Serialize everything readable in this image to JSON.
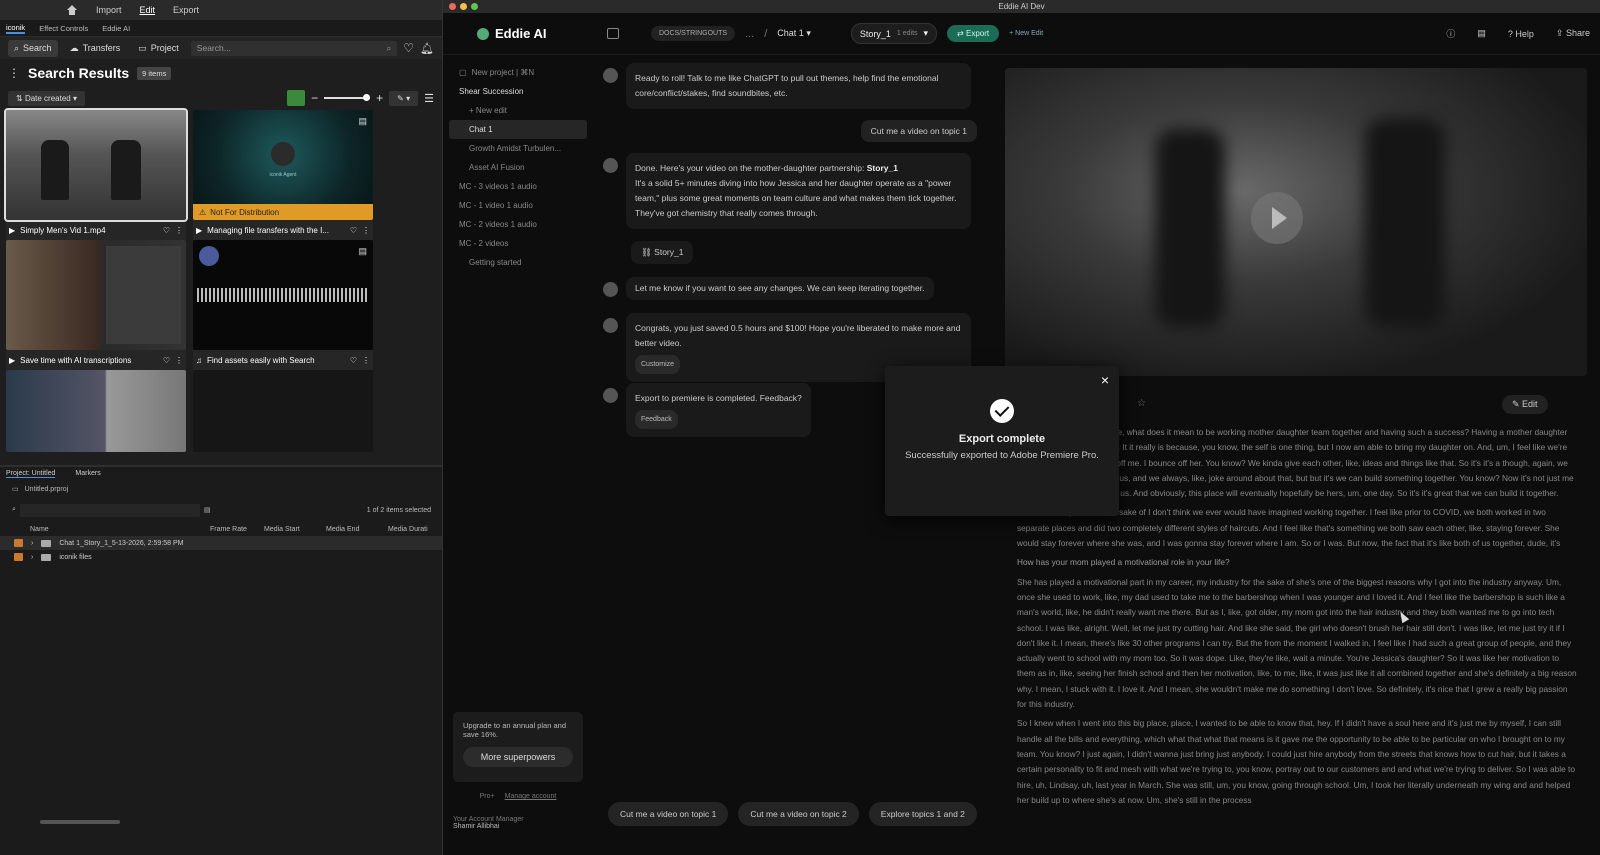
{
  "premiere": {
    "menu": [
      "Import",
      "Edit",
      "Export"
    ],
    "active_menu": "Edit",
    "panel_tabs": [
      "iconik",
      "Effect Controls",
      "Eddie AI"
    ],
    "iconik_nav": {
      "search": "Search",
      "transfers": "Transfers",
      "project": "Project",
      "search_placeholder": "Search..."
    },
    "results_title": "Search Results",
    "results_count": "9 items",
    "sort_label": "Date created",
    "cards": [
      {
        "title": "Simply Men's Vid 1.mp4"
      },
      {
        "title": "Managing file transfers with the I...",
        "warning": "Not For Distribution",
        "thumb_text": "iconik Agent"
      },
      {
        "title": "Save time with AI transcriptions"
      },
      {
        "title": "Find assets easily with Search"
      }
    ],
    "project": {
      "tabs": [
        "Project: Untitled",
        "Markers"
      ],
      "file": "Untitled.prproj",
      "selected_info": "1 of 2 items selected",
      "columns": [
        "Name",
        "Frame Rate",
        "Media Start",
        "Media End",
        "Media Durati"
      ],
      "rows": [
        "Chat 1_Story_1_5-13-2026, 2:59:58 PM",
        "iconik files"
      ]
    }
  },
  "eddie": {
    "window_title": "Eddie AI Dev",
    "app_name": "Eddie AI",
    "crumbs": {
      "docs": "DOCS/STRINGOUTS",
      "sep": "...",
      "chat": "Chat 1"
    },
    "story_pill": "Story_1",
    "story_edits": "1 edits",
    "export_label": "Export",
    "new_edit": "+ New Edit",
    "right_actions": [
      "Help",
      "Share"
    ],
    "sidebar": {
      "new_project": "New project | ⌘N",
      "items": [
        {
          "label": "Shear Succession",
          "cls": "bright"
        },
        {
          "label": "+ New edit",
          "cls": "indent"
        },
        {
          "label": "Chat 1",
          "cls": "sel indent"
        },
        {
          "label": "Growth Amidst Turbulen...",
          "cls": "indent"
        },
        {
          "label": "Asset AI Fusion",
          "cls": "indent"
        },
        {
          "label": "MC - 3 videos 1 audio",
          "cls": ""
        },
        {
          "label": "MC - 1 video 1 audio",
          "cls": ""
        },
        {
          "label": "MC - 2 videos 1 audio",
          "cls": ""
        },
        {
          "label": "MC - 2 videos",
          "cls": ""
        },
        {
          "label": "Getting started",
          "cls": "indent"
        }
      ],
      "upgrade_text": "Upgrade to an annual plan and save 16%.",
      "upgrade_btn": "More superpowers",
      "plan": "Pro+",
      "manage": "Manage account",
      "manager_label": "Your Account Manager",
      "manager_name": "Shamir Allibhai"
    },
    "chat": {
      "m1": "Ready to roll! Talk to me like ChatGPT to pull out themes, help find the emotional core/conflict/stakes, find soundbites, etc.",
      "u1": "Cut me a video on topic 1",
      "m2a": "Done. Here's your video on the mother-daughter partnership:",
      "m2b": "Story_1",
      "m2c": "It's a solid 5+ minutes diving into how Jessica and her daughter operate as a \"power team,\" plus some great moments on team culture and what makes them tick together. They've got chemistry that really comes through.",
      "story_chip": "Story_1",
      "m3": "Let me know if you want to see any changes. We can keep iterating together.",
      "m4": "Congrats, you just saved 0.5 hours and $100! Hope you're liberated to make more and better video.",
      "m4_btn": "Customize",
      "m5": "Export to premiere is completed. Feedback?",
      "m5_btn": "Feedback",
      "suggestions": [
        "Cut me a video on topic 1",
        "Cut me a video on topic 2",
        "Explore topics 1 and 2"
      ]
    },
    "edit_btn": "Edit",
    "transcript": [
      "together with you guys? Like, what does it mean to be working mother daughter team together and having such a success? Having a mother daughter team here, it's just amazing. It it really is because, you know, the self is one thing, but I now am able to bring my daughter on. And, um, I feel like we're we're a power team. You s off me. I bounce off her. You know? We kinda give each other, like, ideas and things like that. So it's it's a though, again, we have two chairs in between us, and we always, like, joke around about that, but but it's we can build something together. You know? Now it's not just me anymore. It's it's the both of us. And obviously, this place will eventually hopefully be hers, um, one day. So it's it's great that we can build it together.",
      "I think it's really cool for the sake of I don't think we ever would have imagined working together. I feel like prior to COVID, we both worked in two separate places and did two completely different styles of haircuts. And I feel like that's something we both saw each other, like, staying forever. She would stay forever where she was, and I was gonna stay forever where I am. So or I was. But now, the fact that it's like both of us together, dude, it's",
      "How has your mom played a motivational role in your life?",
      "She has played a motivational part in my career, my industry for the sake of she's one of the biggest reasons why I got into the industry anyway. Um, once she used to work, like, my dad used to take me to the barbershop when I was younger and I loved it. And I feel like the barbershop is such like a man's world, like, he didn't really want me there. But as I, like, got older, my mom got into the hair industry and they both wanted me to go into tech school. I was like, alright. Well, let me just try cutting hair. And like she said, the girl who doesn't brush her hair still don't. I was like, let me just try it if I don't like it. I mean, there's like 30 other programs I can try. But the from the moment I walked in, I feel like I had such a great group of people, and they actually went to school with my mom too. So it was dope. Like, they're like, wait a minute. You're Jessica's daughter? So it was like her motivation to them as in, like, seeing her finish school and then her motivation, like, to me, like, it was just like it all combined together and she's definitely a big reason why. I mean, I stuck with it. I love it. And I mean, she wouldn't make me do something I don't love. So definitely, it's nice that I grew a really big passion for this industry.",
      "So I knew when I went into this big place, place, I wanted to be able to know that, hey. If I didn't have a soul here and it's just me by myself, I can still handle all the bills and everything, which what that what that means is it gave me the opportunity to be able to be particular on who I brought on to my team. You know? I just again, I didn't wanna just bring just anybody. I could just hire anybody from the streets that knows how to cut hair, but it takes a certain personality to fit and mesh with what we're trying to, you know, portray out to our customers and and what we're trying to deliver. So I was able to hire, uh, Lindsay, uh, last year in March. She was still, um, you know, going through school. Um, I took her literally underneath my wing and and helped her build up to where she's at now. Um, she's still in the process"
    ],
    "modal": {
      "title": "Export complete",
      "message": "Successfully exported to Adobe Premiere Pro."
    }
  }
}
